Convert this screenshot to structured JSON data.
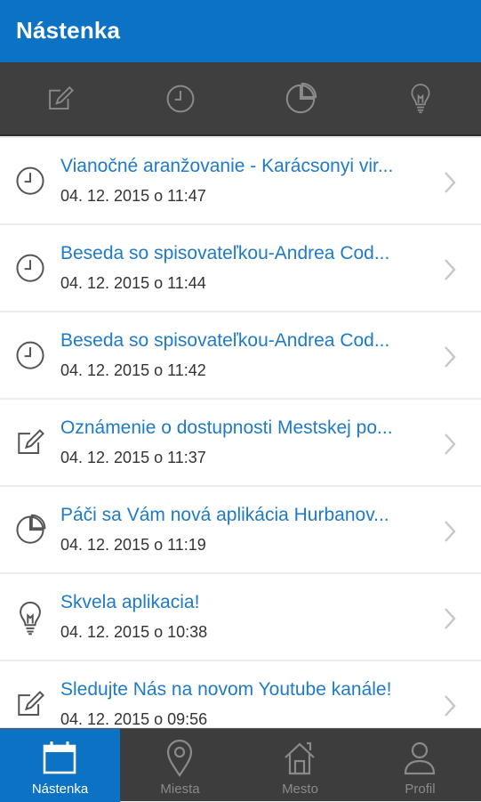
{
  "header": {
    "title": "Nástenka"
  },
  "filters": [
    {
      "icon": "edit-note-icon"
    },
    {
      "icon": "clock-icon"
    },
    {
      "icon": "pie-chart-icon"
    },
    {
      "icon": "lightbulb-icon"
    }
  ],
  "items": [
    {
      "icon": "clock-icon",
      "title": "Vianočné aranžovanie - Karácsonyi vir...",
      "date": "04. 12. 2015 o 11:47"
    },
    {
      "icon": "clock-icon",
      "title": "Beseda so spisovateľkou-Andrea Cod...",
      "date": "04. 12. 2015 o 11:44"
    },
    {
      "icon": "clock-icon",
      "title": "Beseda so spisovateľkou-Andrea Cod...",
      "date": "04. 12. 2015 o 11:42"
    },
    {
      "icon": "edit-note-icon",
      "title": "Oznámenie o dostupnosti Mestskej po...",
      "date": "04. 12. 2015 o 11:37"
    },
    {
      "icon": "pie-chart-icon",
      "title": "Páči sa Vám nová aplikácia Hurbanov...",
      "date": "04. 12. 2015 o 11:19"
    },
    {
      "icon": "lightbulb-icon",
      "title": "Skvela aplikacia!",
      "date": "04. 12. 2015 o 10:38"
    },
    {
      "icon": "edit-note-icon",
      "title": "Sledujte Nás na novom Youtube kanále!",
      "date": "04. 12. 2015 o 09:56"
    }
  ],
  "tabs": [
    {
      "label": "Nástenka",
      "icon": "calendar-icon",
      "active": true
    },
    {
      "label": "Miesta",
      "icon": "map-pin-icon",
      "active": false
    },
    {
      "label": "Mesto",
      "icon": "home-icon",
      "active": false
    },
    {
      "label": "Profil",
      "icon": "person-icon",
      "active": false
    }
  ],
  "colors": {
    "accent": "#0b72c4",
    "link": "#1f7ac7",
    "dark_bar": "#3f3f3f"
  }
}
